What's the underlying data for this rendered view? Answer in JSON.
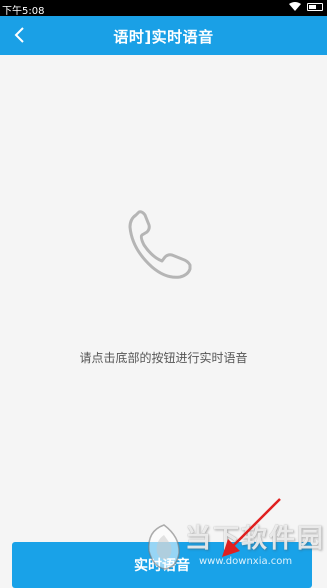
{
  "status_bar": {
    "time": "下午5:08",
    "icons": [
      "wifi-icon",
      "battery-icon"
    ]
  },
  "header": {
    "back_icon": "chevron-left-icon",
    "title": "语时]实时语音",
    "background_color": "#1aa0e6"
  },
  "main": {
    "illustration_icon": "phone-handset-icon",
    "hint_text": "请点击底部的按钮进行实时语音"
  },
  "footer": {
    "button_label": "实时语音",
    "button_color": "#19a2e8"
  },
  "overlay": {
    "watermark_text": "当下软件园",
    "watermark_url": "www.downxia.com",
    "arrow_color": "#e02020"
  }
}
